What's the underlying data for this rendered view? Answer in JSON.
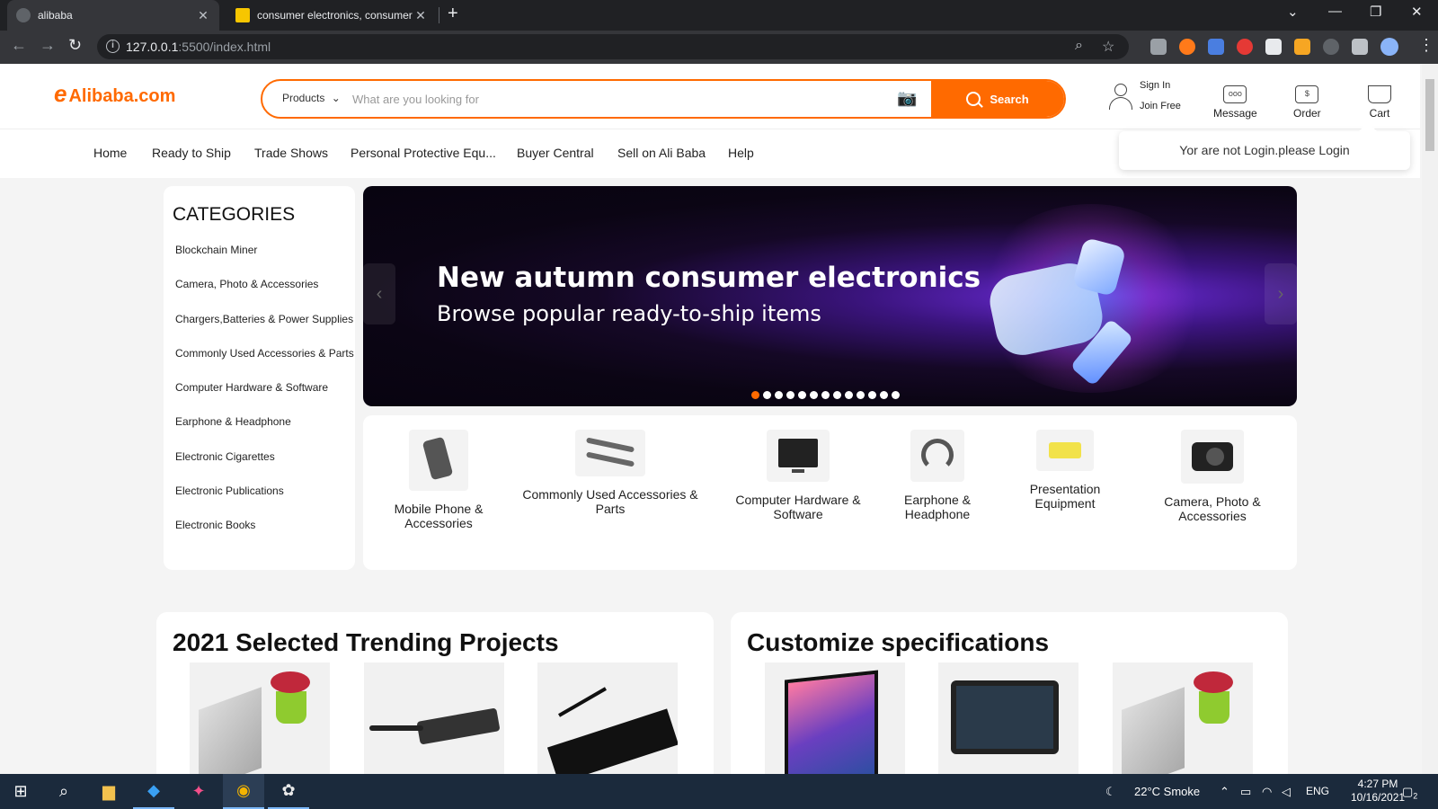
{
  "browser": {
    "tabs": [
      {
        "title": "alibaba",
        "active": true
      },
      {
        "title": "consumer electronics, consumer",
        "active": false
      }
    ],
    "url_host": "127.0.0.1",
    "url_rest": ":5500/index.html"
  },
  "header": {
    "logo_mark": "e",
    "logo_text": "Alibaba.com",
    "search": {
      "category": "Products",
      "placeholder": "What are you looking for",
      "button": "Search"
    },
    "sign_in": "Sign In",
    "join_free": "Join Free",
    "message": "Message",
    "order": "Order",
    "cart": "Cart",
    "login_tip": "Yor are not Login.please Login"
  },
  "nav": [
    "Home",
    "Ready to Ship",
    "Trade Shows",
    "Personal Protective Equ...",
    "Buyer Central",
    "Sell on Ali Baba",
    "Help"
  ],
  "categories": {
    "title": "CATEGORIES",
    "items": [
      "Blockchain Miner",
      "Camera, Photo & Accessories",
      "Chargers,Batteries & Power Supplies",
      "Commonly Used Accessories & Parts",
      "Computer Hardware & Software",
      "Earphone & Headphone",
      "Electronic Cigarettes",
      "Electronic Publications",
      "Electronic Books"
    ]
  },
  "banner": {
    "headline": "New autumn consumer electronics",
    "subline": "Browse popular ready-to-ship items",
    "slide_count": 13,
    "active_slide": 0
  },
  "tiles": [
    {
      "line1": "Mobile Phone &",
      "line2": "Accessories",
      "icon": "phone-holder-icon"
    },
    {
      "line1": "Commonly Used Accessories &",
      "line2": "Parts",
      "icon": "cable-icon"
    },
    {
      "line1": "Computer Hardware &",
      "line2": "Software",
      "icon": "monitor-icon"
    },
    {
      "line1": "Earphone &",
      "line2": "Headphone",
      "icon": "headphone-icon"
    },
    {
      "line1": "Presentation",
      "line2": "Equipment",
      "icon": "projector-icon"
    },
    {
      "line1": "Camera, Photo &",
      "line2": "Accessories",
      "icon": "camera-icon"
    }
  ],
  "sections": {
    "trending_title": "2021 Selected Trending Projects",
    "custom_title": "Customize specifications"
  },
  "taskbar": {
    "weather": "22°C  Smoke",
    "lang": "ENG",
    "time": "4:27 PM",
    "date": "10/16/2021",
    "notifications": "2"
  },
  "colors": {
    "brand": "#ff6a00",
    "chrome_dark": "#202124",
    "taskbar": "#1b2a3c"
  }
}
